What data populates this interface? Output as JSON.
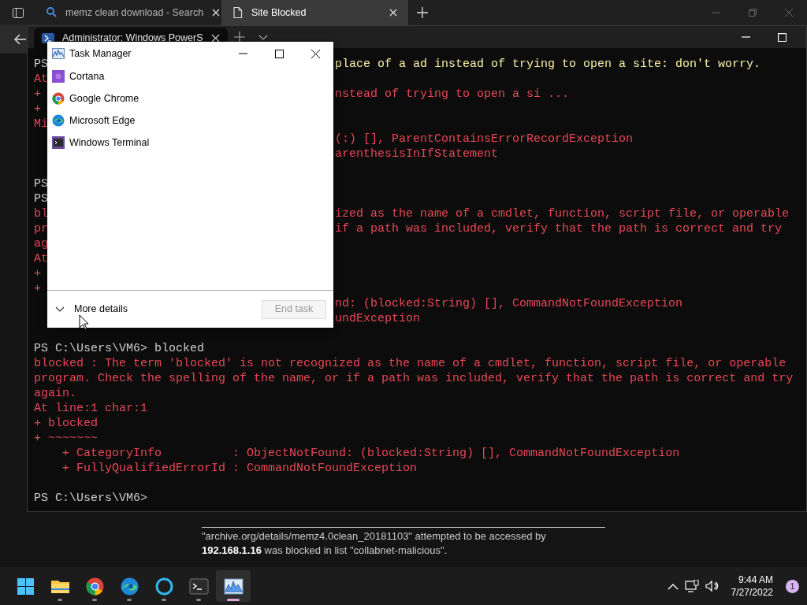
{
  "browser": {
    "tabs": [
      {
        "label": "memz clean download - Search",
        "selected": false
      },
      {
        "label": "Site Blocked",
        "selected": true
      }
    ],
    "page": {
      "notice_line": "\"archive.org/details/memz4.0clean_20181103\" attempted to be accessed by",
      "blocked_line": "**192.168.1.16** was blocked in list \"collabnet-malicious\"."
    }
  },
  "terminal": {
    "tab_title": "Administrator: Windows PowerS",
    "lines": [
      {
        "kind": "command",
        "left": "PS",
        "right": "place of a ad instead of trying to open a site: don't worry."
      },
      {
        "kind": "error",
        "left": "At"
      },
      {
        "kind": "error",
        "left": "+",
        "right": "nstead of trying to open a si ..."
      },
      {
        "kind": "error",
        "left": "+"
      },
      {
        "kind": "error",
        "left": "Mi"
      },
      {
        "kind": "error",
        "right": "(:) [], ParentContainsErrorRecordException"
      },
      {
        "kind": "error",
        "right": "arenthesisInIfStatement"
      },
      {
        "kind": "blank"
      },
      {
        "kind": "prompt",
        "left": "PS"
      },
      {
        "kind": "prompt",
        "left": "PS"
      },
      {
        "kind": "error",
        "left": "bl",
        "right": "ized as the name of a cmdlet, function, script file, or operable"
      },
      {
        "kind": "error",
        "left": "pr",
        "right": "if a path was included, verify that the path is correct and try"
      },
      {
        "kind": "error",
        "left": "ag"
      },
      {
        "kind": "error",
        "left": "At"
      },
      {
        "kind": "error",
        "left": "+"
      },
      {
        "kind": "error",
        "left": "+"
      },
      {
        "kind": "error",
        "right": "nd: (blocked:String) [], CommandNotFoundException"
      },
      {
        "kind": "error",
        "right": "undException"
      },
      {
        "kind": "blank"
      },
      {
        "kind": "prompt",
        "text": "PS C:\\Users\\VM6> blocked"
      },
      {
        "kind": "error",
        "text": "blocked : The term 'blocked' is not recognized as the name of a cmdlet, function, script file, or operable"
      },
      {
        "kind": "error",
        "text": "program. Check the spelling of the name, or if a path was included, verify that the path is correct and try"
      },
      {
        "kind": "error",
        "text": "again."
      },
      {
        "kind": "error",
        "text": "At line:1 char:1"
      },
      {
        "kind": "error",
        "text": "+ blocked"
      },
      {
        "kind": "error",
        "text": "+ ~~~~~~~"
      },
      {
        "kind": "error",
        "text": "    + CategoryInfo          : ObjectNotFound: (blocked:String) [], CommandNotFoundException"
      },
      {
        "kind": "error",
        "text": "    + FullyQualifiedErrorId : CommandNotFoundException"
      },
      {
        "kind": "blank"
      },
      {
        "kind": "prompt",
        "text": "PS C:\\Users\\VM6>"
      }
    ]
  },
  "task_manager": {
    "title": "Task Manager",
    "apps": [
      {
        "name": "Cortana"
      },
      {
        "name": "Google Chrome"
      },
      {
        "name": "Microsoft Edge"
      },
      {
        "name": "Windows Terminal"
      }
    ],
    "more_details": "More details",
    "end_task": {
      "label": "End task",
      "disabled": true
    }
  },
  "taskbar": {
    "apps": [
      {
        "running": false,
        "selected": false
      },
      {
        "running": true,
        "selected": false
      },
      {
        "running": true,
        "selected": false
      },
      {
        "running": true,
        "selected": false
      },
      {
        "running": true,
        "selected": false
      },
      {
        "running": true,
        "selected": false
      },
      {
        "running": true,
        "selected": true
      }
    ],
    "time": "9:44 AM",
    "date": "7/27/2022",
    "notifications": "1"
  }
}
